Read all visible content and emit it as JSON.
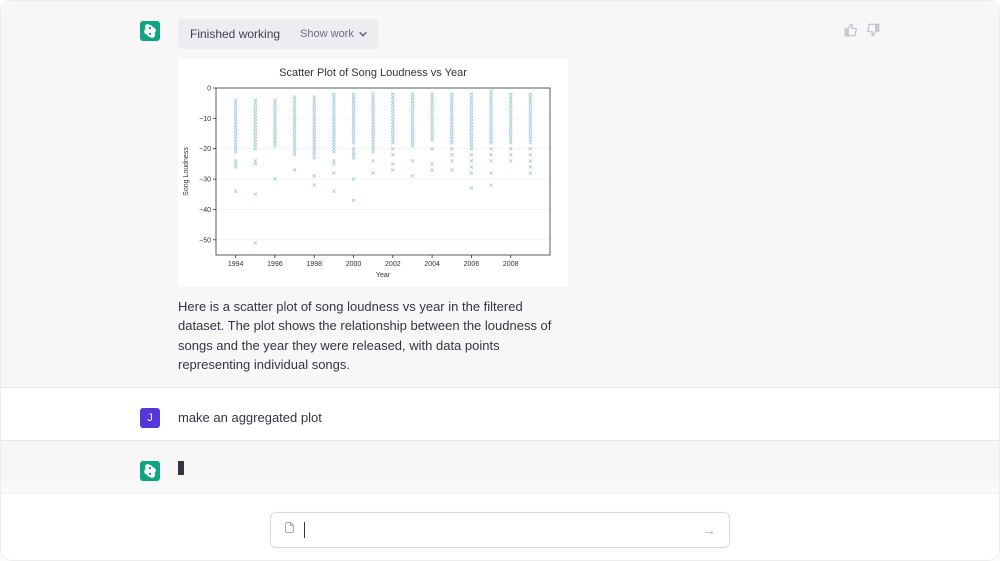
{
  "assistant_status": {
    "label": "Finished working",
    "toggle": "Show work"
  },
  "chart_data": {
    "type": "scatter",
    "title": "Scatter Plot of Song Loudness vs Year",
    "xlabel": "Year",
    "ylabel": "Song Loudness",
    "xlim": [
      1993,
      2010
    ],
    "ylim": [
      -55,
      0
    ],
    "x_ticks": [
      1994,
      1996,
      1998,
      2000,
      2002,
      2004,
      2006,
      2008
    ],
    "y_ticks": [
      0,
      -10,
      -20,
      -30,
      -40,
      -50
    ],
    "years": {
      "1994": [
        -4,
        -5,
        -6,
        -7,
        -8,
        -9,
        -10,
        -11,
        -12,
        -13,
        -14,
        -15,
        -16,
        -17,
        -18,
        -19,
        -20,
        -21,
        -24,
        -25,
        -26,
        -34
      ],
      "1995": [
        -4,
        -5,
        -6,
        -7,
        -8,
        -9,
        -10,
        -11,
        -12,
        -13,
        -14,
        -15,
        -16,
        -17,
        -18,
        -19,
        -20,
        -24,
        -25,
        -35,
        -51
      ],
      "1996": [
        -4,
        -5,
        -6,
        -7,
        -8,
        -9,
        -10,
        -11,
        -12,
        -13,
        -14,
        -15,
        -16,
        -17,
        -18,
        -19,
        -30
      ],
      "1997": [
        -3,
        -4,
        -5,
        -6,
        -7,
        -8,
        -9,
        -10,
        -11,
        -12,
        -13,
        -14,
        -15,
        -16,
        -17,
        -18,
        -19,
        -20,
        -21,
        -22,
        -27
      ],
      "1998": [
        -3,
        -4,
        -5,
        -6,
        -7,
        -8,
        -9,
        -10,
        -11,
        -12,
        -13,
        -14,
        -15,
        -16,
        -17,
        -18,
        -19,
        -20,
        -21,
        -22,
        -23,
        -29,
        -32
      ],
      "1999": [
        -2,
        -3,
        -4,
        -5,
        -6,
        -7,
        -8,
        -9,
        -10,
        -11,
        -12,
        -13,
        -14,
        -15,
        -16,
        -17,
        -18,
        -19,
        -20,
        -21,
        -24,
        -25,
        -28,
        -34
      ],
      "2000": [
        -2,
        -3,
        -4,
        -5,
        -6,
        -7,
        -8,
        -9,
        -10,
        -11,
        -12,
        -13,
        -14,
        -15,
        -16,
        -17,
        -18,
        -20,
        -21,
        -22,
        -23,
        -30,
        -37
      ],
      "2001": [
        -2,
        -3,
        -4,
        -5,
        -6,
        -7,
        -8,
        -9,
        -10,
        -11,
        -12,
        -13,
        -14,
        -15,
        -16,
        -17,
        -18,
        -19,
        -20,
        -21,
        -24,
        -28
      ],
      "2002": [
        -2,
        -3,
        -4,
        -5,
        -6,
        -7,
        -8,
        -9,
        -10,
        -11,
        -12,
        -13,
        -14,
        -15,
        -16,
        -17,
        -18,
        -20,
        -22,
        -25,
        -27
      ],
      "2003": [
        -2,
        -3,
        -4,
        -5,
        -6,
        -7,
        -8,
        -9,
        -10,
        -11,
        -12,
        -13,
        -14,
        -15,
        -16,
        -17,
        -18,
        -19,
        -24,
        -29
      ],
      "2004": [
        -2,
        -3,
        -4,
        -5,
        -6,
        -7,
        -8,
        -9,
        -10,
        -11,
        -12,
        -13,
        -14,
        -15,
        -16,
        -17,
        -20,
        -25,
        -27
      ],
      "2005": [
        -2,
        -3,
        -4,
        -5,
        -6,
        -7,
        -8,
        -9,
        -10,
        -11,
        -12,
        -13,
        -14,
        -15,
        -16,
        -17,
        -18,
        -20,
        -22,
        -24,
        -27
      ],
      "2006": [
        -2,
        -3,
        -4,
        -5,
        -6,
        -7,
        -8,
        -9,
        -10,
        -11,
        -12,
        -13,
        -14,
        -15,
        -16,
        -17,
        -18,
        -19,
        -20,
        -22,
        -24,
        -26,
        -28,
        -33
      ],
      "2007": [
        -1,
        -2,
        -3,
        -4,
        -5,
        -6,
        -7,
        -8,
        -9,
        -10,
        -11,
        -12,
        -13,
        -14,
        -15,
        -16,
        -17,
        -18,
        -20,
        -22,
        -24,
        -28,
        -32
      ],
      "2008": [
        -2,
        -3,
        -4,
        -5,
        -6,
        -7,
        -8,
        -9,
        -10,
        -11,
        -12,
        -13,
        -14,
        -15,
        -16,
        -17,
        -18,
        -20,
        -22,
        -24
      ],
      "2009": [
        -2,
        -3,
        -4,
        -5,
        -6,
        -7,
        -8,
        -9,
        -10,
        -11,
        -12,
        -13,
        -14,
        -15,
        -16,
        -17,
        -18,
        -20,
        -22,
        -24,
        -26,
        -28
      ]
    }
  },
  "assistant_explanation": "Here is a scatter plot of song loudness vs year in the filtered dataset. The plot shows the relationship between the loudness of songs and the year they were released, with data points representing individual songs.",
  "user_message": "make an aggregated plot",
  "user_avatar_letter": "J",
  "composer": {
    "placeholder": "",
    "send_label": "→"
  }
}
